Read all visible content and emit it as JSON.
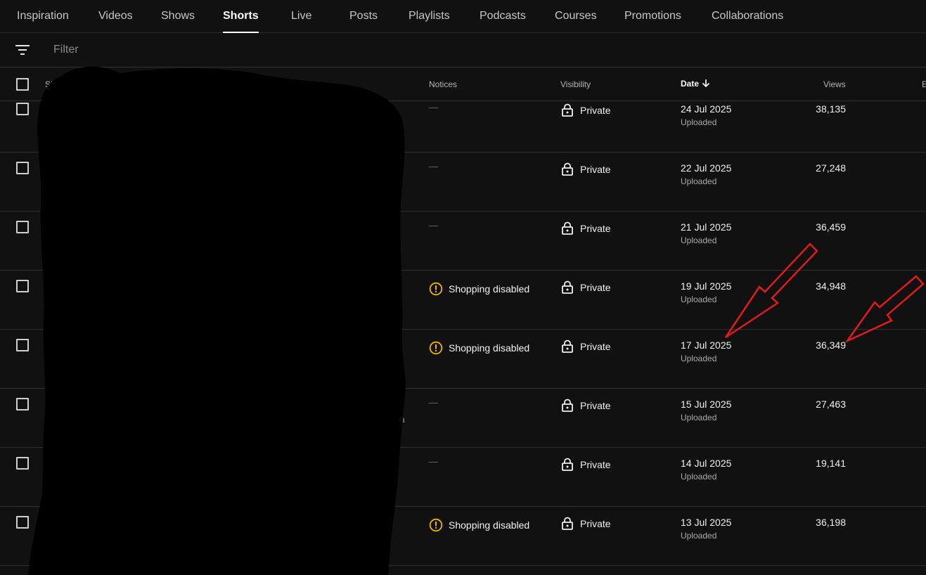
{
  "tabs": [
    {
      "label": "Inspiration",
      "active": false
    },
    {
      "label": "Videos",
      "active": false
    },
    {
      "label": "Shows",
      "active": false
    },
    {
      "label": "Shorts",
      "active": true
    },
    {
      "label": "Live",
      "active": false
    },
    {
      "label": "Posts",
      "active": false
    },
    {
      "label": "Playlists",
      "active": false
    },
    {
      "label": "Podcasts",
      "active": false
    },
    {
      "label": "Courses",
      "active": false
    },
    {
      "label": "Promotions",
      "active": false
    },
    {
      "label": "Collaborations",
      "active": false
    }
  ],
  "filter": {
    "icon": "filter-lines-icon",
    "placeholder": "Filter",
    "value": ""
  },
  "table": {
    "headers": {
      "short": "Sh",
      "notices": "Notices",
      "visibility": "Visibility",
      "date": "Date",
      "views": "Views",
      "extra": "E"
    },
    "sort": {
      "column": "date",
      "direction": "descending",
      "icon": "arrow-down-icon"
    },
    "rows": [
      {
        "notice": "—",
        "notice_type": "none",
        "visibility": "Private",
        "date": "24 Jul 2025",
        "date_status": "Uploaded",
        "views": "38,135"
      },
      {
        "notice": "—",
        "notice_type": "none",
        "visibility": "Private",
        "date": "22 Jul 2025",
        "date_status": "Uploaded",
        "views": "27,248"
      },
      {
        "notice": "—",
        "notice_type": "none",
        "visibility": "Private",
        "date": "21 Jul 2025",
        "date_status": "Uploaded",
        "views": "36,459"
      },
      {
        "notice": "Shopping disabled",
        "notice_type": "warning",
        "visibility": "Private",
        "date": "19 Jul 2025",
        "date_status": "Uploaded",
        "views": "34,948"
      },
      {
        "notice": "Shopping disabled",
        "notice_type": "warning",
        "visibility": "Private",
        "date": "17 Jul 2025",
        "date_status": "Uploaded",
        "views": "36,349"
      },
      {
        "notice": "—",
        "notice_type": "none",
        "visibility": "Private",
        "date": "15 Jul 2025",
        "date_status": "Uploaded",
        "views": "27,463"
      },
      {
        "notice": "—",
        "notice_type": "none",
        "visibility": "Private",
        "date": "14 Jul 2025",
        "date_status": "Uploaded",
        "views": "19,141"
      },
      {
        "notice": "Shopping disabled",
        "notice_type": "warning",
        "visibility": "Private",
        "date": "13 Jul 2025",
        "date_status": "Uploaded",
        "views": "36,198"
      }
    ]
  },
  "stray_text": "a",
  "colors": {
    "background": "#111111",
    "divider": "#303030",
    "warning": "#f2b200",
    "annotation_arrow": "#e01b1b",
    "redaction": "#000000"
  }
}
